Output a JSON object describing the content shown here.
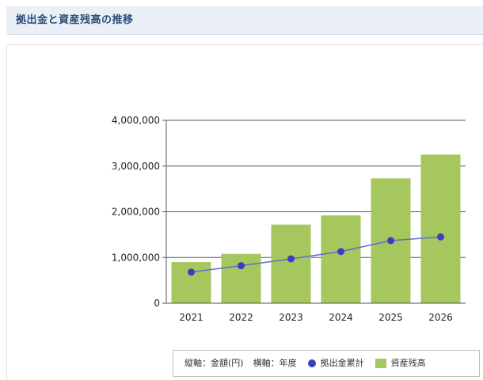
{
  "panel": {
    "title": "拠出金と資産残高の推移"
  },
  "legend": {
    "y_axis_note": "縦軸：金額(円)",
    "x_axis_note": "横軸：年度",
    "contribution_label": "拠出金累計",
    "assets_label": "資産残高"
  },
  "colors": {
    "bar": "#a6c65e",
    "line": "#5a6fd0",
    "marker": "#3a3fbf",
    "header_bg": "#eaf0f6",
    "title": "#2a4d7a"
  },
  "chart_data": {
    "type": "bar",
    "categories": [
      "2021",
      "2022",
      "2023",
      "2024",
      "2025",
      "2026"
    ],
    "ylim": [
      0,
      4000000
    ],
    "yticks": [
      0,
      1000000,
      2000000,
      3000000,
      4000000
    ],
    "ytick_labels": [
      "0",
      "1,000,000",
      "2,000,000",
      "3,000,000",
      "4,000,000"
    ],
    "grid": true,
    "legend_position": "bottom-right",
    "series": [
      {
        "name": "資産残高",
        "type": "bar",
        "values": [
          900000,
          1080000,
          1720000,
          1920000,
          2730000,
          3250000
        ]
      },
      {
        "name": "拠出金累計",
        "type": "line",
        "values": [
          680000,
          820000,
          970000,
          1130000,
          1370000,
          1450000
        ]
      }
    ]
  }
}
